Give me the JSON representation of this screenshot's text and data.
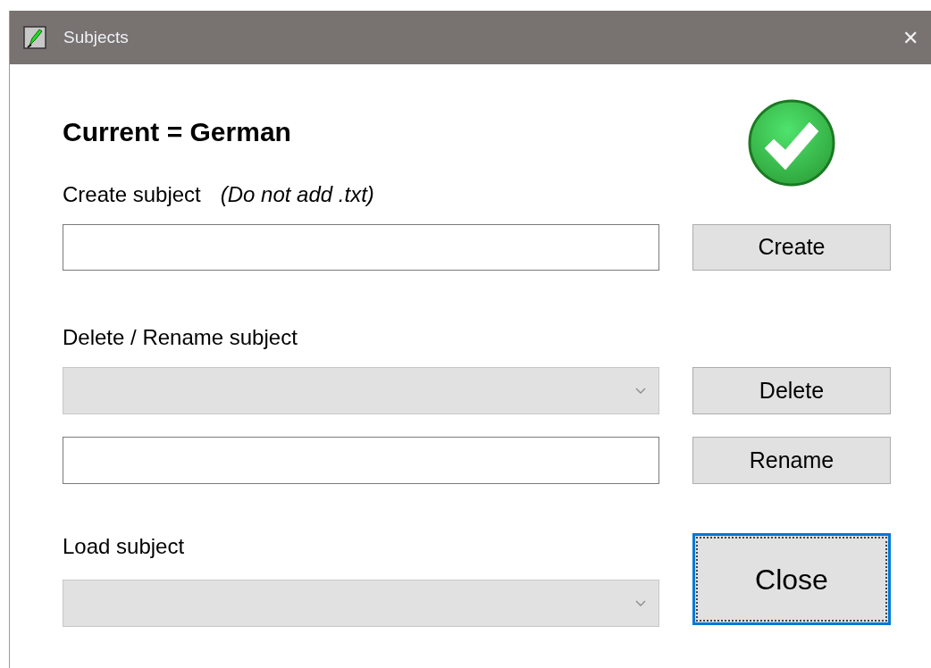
{
  "window": {
    "title": "Subjects",
    "close": "✕"
  },
  "heading": "Current = German",
  "status": {
    "ok": true
  },
  "create": {
    "label": "Create subject",
    "hint": "(Do not add .txt)",
    "button": "Create"
  },
  "manage": {
    "label": "Delete / Rename subject",
    "dropdown": {
      "disabled": true
    },
    "delete_button": "Delete",
    "rename_button": "Rename"
  },
  "load": {
    "label": "Load subject",
    "dropdown": {
      "disabled": true
    }
  },
  "close_button": {
    "label": "Close",
    "focused": true
  }
}
